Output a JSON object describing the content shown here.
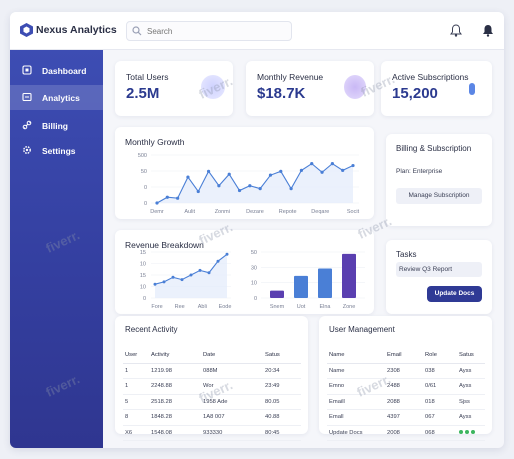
{
  "app": {
    "name": "Nexus Analytics"
  },
  "search": {
    "placeholder": "Search"
  },
  "sidebar": {
    "items": [
      {
        "label": "Dashboard",
        "icon": "grid-icon"
      },
      {
        "label": "Analytics",
        "icon": "chart-icon",
        "active": true
      },
      {
        "label": "Billing",
        "icon": "link-icon"
      },
      {
        "label": "Settings",
        "icon": "gear-icon"
      }
    ]
  },
  "stats": [
    {
      "label": "Total Users",
      "value": "2.5M"
    },
    {
      "label": "Monthly Revenue",
      "value": "$18.7K"
    },
    {
      "label": "Active Subscriptions",
      "value": "15,200"
    }
  ],
  "growth": {
    "title": "Monthly Growth",
    "yticks": [
      "500",
      "50",
      "0",
      "0"
    ],
    "xticks": [
      "Demr",
      "Aulit",
      "Zonmi",
      "Dezare",
      "Repote",
      "Deqare",
      "Socit"
    ]
  },
  "breakdown": {
    "title": "Revenue Breakdown",
    "line_yticks": [
      "15",
      "10",
      "15",
      "10",
      "0"
    ],
    "line_xticks": [
      "Fore",
      "Ree",
      "Abli",
      "Eode"
    ],
    "bar_yticks": [
      "50",
      "30",
      "10",
      "0"
    ],
    "bar_xticks": [
      "Snem",
      "Uot",
      "Elna",
      "Zone"
    ]
  },
  "billing": {
    "title": "Billing & Subscription",
    "plan": "Plan: Enterprise",
    "manage_label": "Manage Subscription"
  },
  "tasks": {
    "title": "Tasks",
    "item": "Review Q3 Report",
    "button": "Update Docs"
  },
  "activity": {
    "title": "Recent Activity",
    "headers": [
      "User",
      "Activity",
      "Date",
      "Satus"
    ],
    "rows": [
      [
        "1",
        "1219.98",
        "088M",
        "20:34"
      ],
      [
        "1",
        "2248.88",
        "Wor",
        "23:49"
      ],
      [
        "5",
        "2518.28",
        "1958 Ade",
        "80.05"
      ],
      [
        "8",
        "1848.28",
        "1A8 007",
        "40.88"
      ],
      [
        "X6",
        "1548.08",
        "933330",
        "80:45"
      ]
    ]
  },
  "users": {
    "title": "User Management",
    "headers": [
      "Name",
      "Email",
      "Role",
      "Satus"
    ],
    "rows": [
      [
        "Name",
        "2308",
        "038",
        "Ayss"
      ],
      [
        "Emno",
        "2488",
        "0/61",
        "Ayss"
      ],
      [
        "Emaill",
        "2088",
        "018",
        "Sjss"
      ],
      [
        "Emall",
        "4397",
        "067",
        "Ayss"
      ],
      [
        "Update Docs",
        "2008",
        "068",
        ""
      ]
    ]
  },
  "watermark": "fiverr.",
  "colors": {
    "accent": "#2f3a95",
    "chart_line": "#4a7fd6",
    "bar_blue": "#4a7fd6",
    "bar_purple": "#5a3fb0"
  },
  "chart_data": [
    {
      "type": "line",
      "title": "Monthly Growth",
      "x": [
        "Demr",
        "Aulit",
        "Zonmi",
        "Dezare",
        "Repote",
        "Deqare",
        "Socit"
      ],
      "series": [
        {
          "values": [
            0,
            60,
            50,
            270,
            120,
            330,
            180,
            300,
            130,
            180,
            150,
            290,
            330,
            150,
            340,
            410,
            320,
            410,
            340,
            390
          ]
        }
      ],
      "ylim": [
        0,
        500
      ]
    },
    {
      "type": "line",
      "title": "Revenue Breakdown",
      "x": [
        "Fore",
        "Ree",
        "Abli",
        "Eode"
      ],
      "series": [
        {
          "values": [
            6,
            7,
            9,
            8,
            10,
            12,
            11,
            16,
            19
          ]
        }
      ],
      "ylim": [
        0,
        20
      ]
    },
    {
      "type": "bar",
      "categories": [
        "Snem",
        "Uot",
        "Elna",
        "Zone"
      ],
      "series": [
        {
          "values": [
            8,
            24,
            32,
            48
          ]
        }
      ],
      "ylim": [
        0,
        50
      ]
    }
  ]
}
